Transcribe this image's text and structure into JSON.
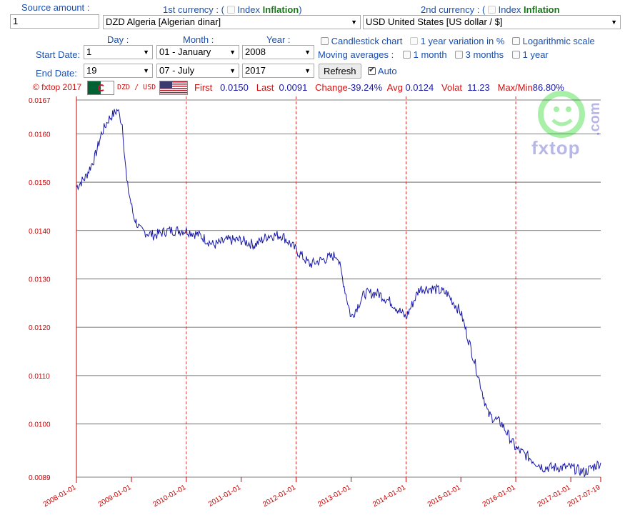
{
  "form": {
    "source_amount_label": "Source amount :",
    "source_amount_value": "1",
    "first_currency_label": "1st currency : (",
    "second_currency_label": "2nd currency : (",
    "index_label": "Index",
    "inflation_label": "Inflation",
    "close_paren": ")",
    "first_currency_value": "DZD Algeria [Algerian dinar]",
    "second_currency_value": "USD United States [US dollar / $]",
    "day_header": "Day :",
    "month_header": "Month :",
    "year_header": "Year :",
    "start_date_label": "Start Date:",
    "end_date_label": "End Date:",
    "start_day": "1",
    "start_month": "01 - January",
    "start_year": "2008",
    "end_day": "19",
    "end_month": "07 - July",
    "end_year": "2017",
    "refresh_label": "Refresh",
    "auto_label": "Auto",
    "candlestick_label": "Candlestick chart",
    "year_variation_label": "1 year variation in %",
    "log_scale_label": "Logarithmic scale",
    "moving_averages_label": "Moving averages :",
    "ma_1month": "1 month",
    "ma_3months": "3 months",
    "ma_1year": "1 year"
  },
  "stats": {
    "copyright": "© fxtop 2017",
    "pair": "DZD / USD",
    "first_label": "First",
    "first_value": "0.0150",
    "last_label": "Last",
    "last_value": "0.0091",
    "change_label": "Change",
    "change_value": "-39.24%",
    "avg_label": "Avg",
    "avg_value": "0.0124",
    "volat_label": "Volat",
    "volat_value": "11.23",
    "maxmin_label": "Max/Min",
    "maxmin_value": "86.80%"
  },
  "logo": {
    "text": "fxtop",
    "dotcom": ".com"
  },
  "colors": {
    "line": "#1a1aa8",
    "axis": "#cc0000",
    "grid": "#555555"
  },
  "chart_data": {
    "type": "line",
    "title": "",
    "xlabel": "",
    "ylabel": "",
    "ylim": [
      0.0089,
      0.0167
    ],
    "y_ticks": [
      "0.0167",
      "0.0160",
      "0.0150",
      "0.0140",
      "0.0130",
      "0.0120",
      "0.0110",
      "0.0100",
      "0.0089"
    ],
    "x_ticks": [
      "2008-01-01",
      "2009-01-01",
      "2010-01-01",
      "2011-01-01",
      "2012-01-01",
      "2013-01-01",
      "2014-01-01",
      "2015-01-01",
      "2016-01-01",
      "2017-01-01",
      "2017-07-19"
    ],
    "series": [
      {
        "x": [
          "2008-01-01",
          "2008-03-01",
          "2008-05-01",
          "2008-06-15",
          "2008-08-01",
          "2008-10-01",
          "2008-11-01",
          "2008-12-01",
          "2009-01-15",
          "2009-03-01",
          "2009-06-01",
          "2009-09-01",
          "2010-01-01",
          "2010-04-01",
          "2010-07-01",
          "2010-10-01",
          "2011-01-01",
          "2011-04-01",
          "2011-07-01",
          "2011-10-01",
          "2012-01-01",
          "2012-04-01",
          "2012-07-01",
          "2012-10-01",
          "2013-01-01",
          "2013-04-01",
          "2013-07-01",
          "2013-10-01",
          "2014-01-01",
          "2014-04-01",
          "2014-07-01",
          "2014-10-01",
          "2015-01-01",
          "2015-04-01",
          "2015-07-01",
          "2015-10-01",
          "2016-01-01",
          "2016-04-01",
          "2016-07-01",
          "2016-10-01",
          "2017-01-01",
          "2017-04-01",
          "2017-07-19"
        ],
        "y": [
          0.0149,
          0.0151,
          0.0155,
          0.016,
          0.0163,
          0.0165,
          0.0162,
          0.015,
          0.0143,
          0.014,
          0.0139,
          0.014,
          0.014,
          0.0139,
          0.0137,
          0.0138,
          0.0138,
          0.0137,
          0.0139,
          0.0139,
          0.0136,
          0.0133,
          0.0134,
          0.0135,
          0.0122,
          0.0127,
          0.0127,
          0.0125,
          0.0122,
          0.0128,
          0.0128,
          0.0127,
          0.0123,
          0.0113,
          0.0102,
          0.01,
          0.0095,
          0.0093,
          0.0091,
          0.0091,
          0.0091,
          0.009,
          0.0092
        ]
      }
    ]
  }
}
